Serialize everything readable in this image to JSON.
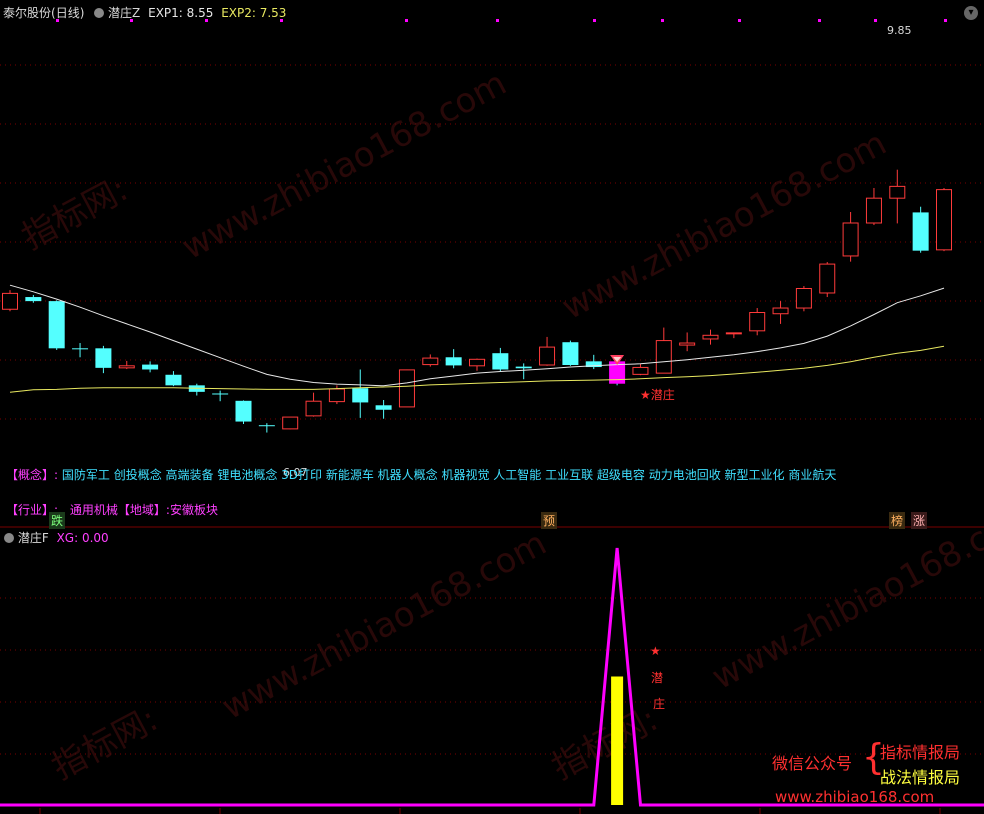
{
  "top_panel": {
    "stock_name": "泰尔股份",
    "period": "(日线)",
    "indicator_name": "潜庄Z",
    "exp1_label": "EXP1: 8.55",
    "exp2_label": "EXP2: 7.53",
    "high_label": "9.85",
    "low_label": "6.07",
    "signal_label": "★潜庄",
    "concept_key": "【概念】:",
    "concept_value": "国防军工 创投概念 高端装备 锂电池概念 3D打印 新能源车 机器人概念 机器视觉 人工智能 工业互联 超级电容 动力电池回收 新型工业化 商业航天",
    "industry_key": "【行业】:",
    "industry_value": "通用机械",
    "region_key": "【地域】:",
    "region_value": "安徽板块",
    "badge_die": "跌",
    "badge_yu": "预",
    "badge_bang": "榜",
    "badge_zhang": "涨"
  },
  "bottom_panel": {
    "indicator_name": "潜庄F",
    "xg_label": "XG: 0.00",
    "signal_star": "★",
    "signal_char1": "潜",
    "signal_char2": "庄"
  },
  "footer": {
    "wechat_label": "微信公众号",
    "brace": "{",
    "account1": "指标情报局",
    "account2": "战法情报局",
    "website": "www.zhibiao168.com"
  },
  "watermark": {
    "text_url": "www.zhibiao168.com",
    "text_cn": "指标网:"
  },
  "colors": {
    "up": "#ff3b3b",
    "down": "#54ffff",
    "ma_short": "#e8e8e8",
    "ma_long": "#e8e860",
    "signal": "#ff00ff",
    "grid": "#7a0000",
    "bar": "#ffff00"
  },
  "chart_data": {
    "type": "candlestick",
    "price_high": 9.85,
    "price_low": 6.07,
    "candles": [
      {
        "o": 7.97,
        "c": 8.36,
        "h": 8.44,
        "l": 7.92
      },
      {
        "o": 8.27,
        "c": 8.17,
        "h": 8.32,
        "l": 8.13
      },
      {
        "o": 8.17,
        "c": 7.01,
        "h": 8.19,
        "l": 6.97
      },
      {
        "o": 7.01,
        "c": 7.01,
        "h": 7.14,
        "l": 6.79
      },
      {
        "o": 7.01,
        "c": 6.53,
        "h": 7.07,
        "l": 6.4
      },
      {
        "o": 6.53,
        "c": 6.58,
        "h": 6.7,
        "l": 6.5
      },
      {
        "o": 6.61,
        "c": 6.49,
        "h": 6.69,
        "l": 6.42
      },
      {
        "o": 6.36,
        "c": 6.1,
        "h": 6.45,
        "l": 6.08
      },
      {
        "o": 6.1,
        "c": 5.94,
        "h": 6.14,
        "l": 5.85
      },
      {
        "o": 5.9,
        "c": 5.9,
        "h": 5.97,
        "l": 5.71
      },
      {
        "o": 5.72,
        "c": 5.21,
        "h": 5.73,
        "l": 5.15
      },
      {
        "o": 5.12,
        "c": 5.12,
        "h": 5.17,
        "l": 4.94
      },
      {
        "o": 5.03,
        "c": 5.32,
        "h": 5.32,
        "l": 5.02
      },
      {
        "o": 5.35,
        "c": 5.71,
        "h": 5.92,
        "l": 5.33
      },
      {
        "o": 5.7,
        "c": 6.01,
        "h": 6.1,
        "l": 5.64
      },
      {
        "o": 6.03,
        "c": 5.68,
        "h": 6.49,
        "l": 5.3
      },
      {
        "o": 5.61,
        "c": 5.5,
        "h": 5.74,
        "l": 5.28
      },
      {
        "o": 5.57,
        "c": 6.48,
        "h": 6.49,
        "l": 5.57
      },
      {
        "o": 6.61,
        "c": 6.77,
        "h": 6.86,
        "l": 6.56
      },
      {
        "o": 6.79,
        "c": 6.59,
        "h": 6.99,
        "l": 6.52
      },
      {
        "o": 6.58,
        "c": 6.74,
        "h": 6.76,
        "l": 6.46
      },
      {
        "o": 6.89,
        "c": 6.49,
        "h": 7.02,
        "l": 6.45
      },
      {
        "o": 6.56,
        "c": 6.52,
        "h": 6.64,
        "l": 6.25
      },
      {
        "o": 6.6,
        "c": 7.04,
        "h": 7.29,
        "l": 6.58
      },
      {
        "o": 7.16,
        "c": 6.6,
        "h": 7.2,
        "l": 6.58
      },
      {
        "o": 6.69,
        "c": 6.55,
        "h": 6.85,
        "l": 6.5
      },
      {
        "o": 6.69,
        "c": 6.14,
        "h": 6.73,
        "l": 6.1
      },
      {
        "o": 6.37,
        "c": 6.54,
        "h": 6.63,
        "l": 6.35
      },
      {
        "o": 6.4,
        "c": 7.2,
        "h": 7.52,
        "l": 6.4
      },
      {
        "o": 7.09,
        "c": 7.14,
        "h": 7.4,
        "l": 6.94
      },
      {
        "o": 7.24,
        "c": 7.33,
        "h": 7.47,
        "l": 7.1
      },
      {
        "o": 7.37,
        "c": 7.39,
        "h": 7.4,
        "l": 7.26
      },
      {
        "o": 7.44,
        "c": 7.89,
        "h": 8.0,
        "l": 7.33
      },
      {
        "o": 7.86,
        "c": 8.0,
        "h": 8.17,
        "l": 7.61
      },
      {
        "o": 8.0,
        "c": 8.48,
        "h": 8.54,
        "l": 7.92
      },
      {
        "o": 8.37,
        "c": 9.08,
        "h": 9.13,
        "l": 8.27
      },
      {
        "o": 9.28,
        "c": 10.09,
        "h": 10.36,
        "l": 9.14
      },
      {
        "o": 10.09,
        "c": 10.7,
        "h": 10.95,
        "l": 10.04
      },
      {
        "o": 10.7,
        "c": 10.99,
        "h": 11.4,
        "l": 10.08
      },
      {
        "o": 10.35,
        "c": 9.41,
        "h": 10.49,
        "l": 9.36
      },
      {
        "o": 9.43,
        "c": 10.91,
        "h": 10.95,
        "l": 9.4
      }
    ],
    "ma_short": [
      8.56,
      8.4,
      8.22,
      8.02,
      7.81,
      7.61,
      7.41,
      7.2,
      6.99,
      6.78,
      6.57,
      6.37,
      6.25,
      6.17,
      6.13,
      6.11,
      6.09,
      6.16,
      6.26,
      6.33,
      6.4,
      6.44,
      6.47,
      6.51,
      6.55,
      6.58,
      6.61,
      6.63,
      6.68,
      6.73,
      6.79,
      6.85,
      6.93,
      7.02,
      7.13,
      7.31,
      7.56,
      7.84,
      8.13,
      8.3,
      8.49
    ],
    "ma_long": [
      5.93,
      5.99,
      6.0,
      6.03,
      6.04,
      6.04,
      6.04,
      6.04,
      6.03,
      6.02,
      6.01,
      6.0,
      6.0,
      6.0,
      6.02,
      6.04,
      6.06,
      6.08,
      6.11,
      6.13,
      6.15,
      6.17,
      6.19,
      6.21,
      6.22,
      6.23,
      6.24,
      6.26,
      6.29,
      6.31,
      6.34,
      6.38,
      6.42,
      6.47,
      6.52,
      6.59,
      6.68,
      6.79,
      6.89,
      6.96,
      7.06
    ],
    "signal_index": 26,
    "indicator_xg": [
      0,
      0,
      0,
      0,
      0,
      0,
      0,
      0,
      0,
      0,
      0,
      0,
      0,
      0,
      0,
      0,
      0,
      0,
      0,
      0,
      0,
      0,
      0,
      0,
      0,
      0,
      1,
      0,
      0,
      0,
      0,
      0,
      0,
      0,
      0,
      0,
      0,
      0,
      0,
      0,
      0
    ],
    "indicator_bar": [
      0,
      0,
      0,
      0,
      0,
      0,
      0,
      0,
      0,
      0,
      0,
      0,
      0,
      0,
      0,
      0,
      0,
      0,
      0,
      0,
      0,
      0,
      0,
      0,
      0,
      0,
      0.5,
      0,
      0,
      0,
      0,
      0,
      0,
      0,
      0,
      0,
      0,
      0,
      0,
      0,
      0
    ]
  }
}
